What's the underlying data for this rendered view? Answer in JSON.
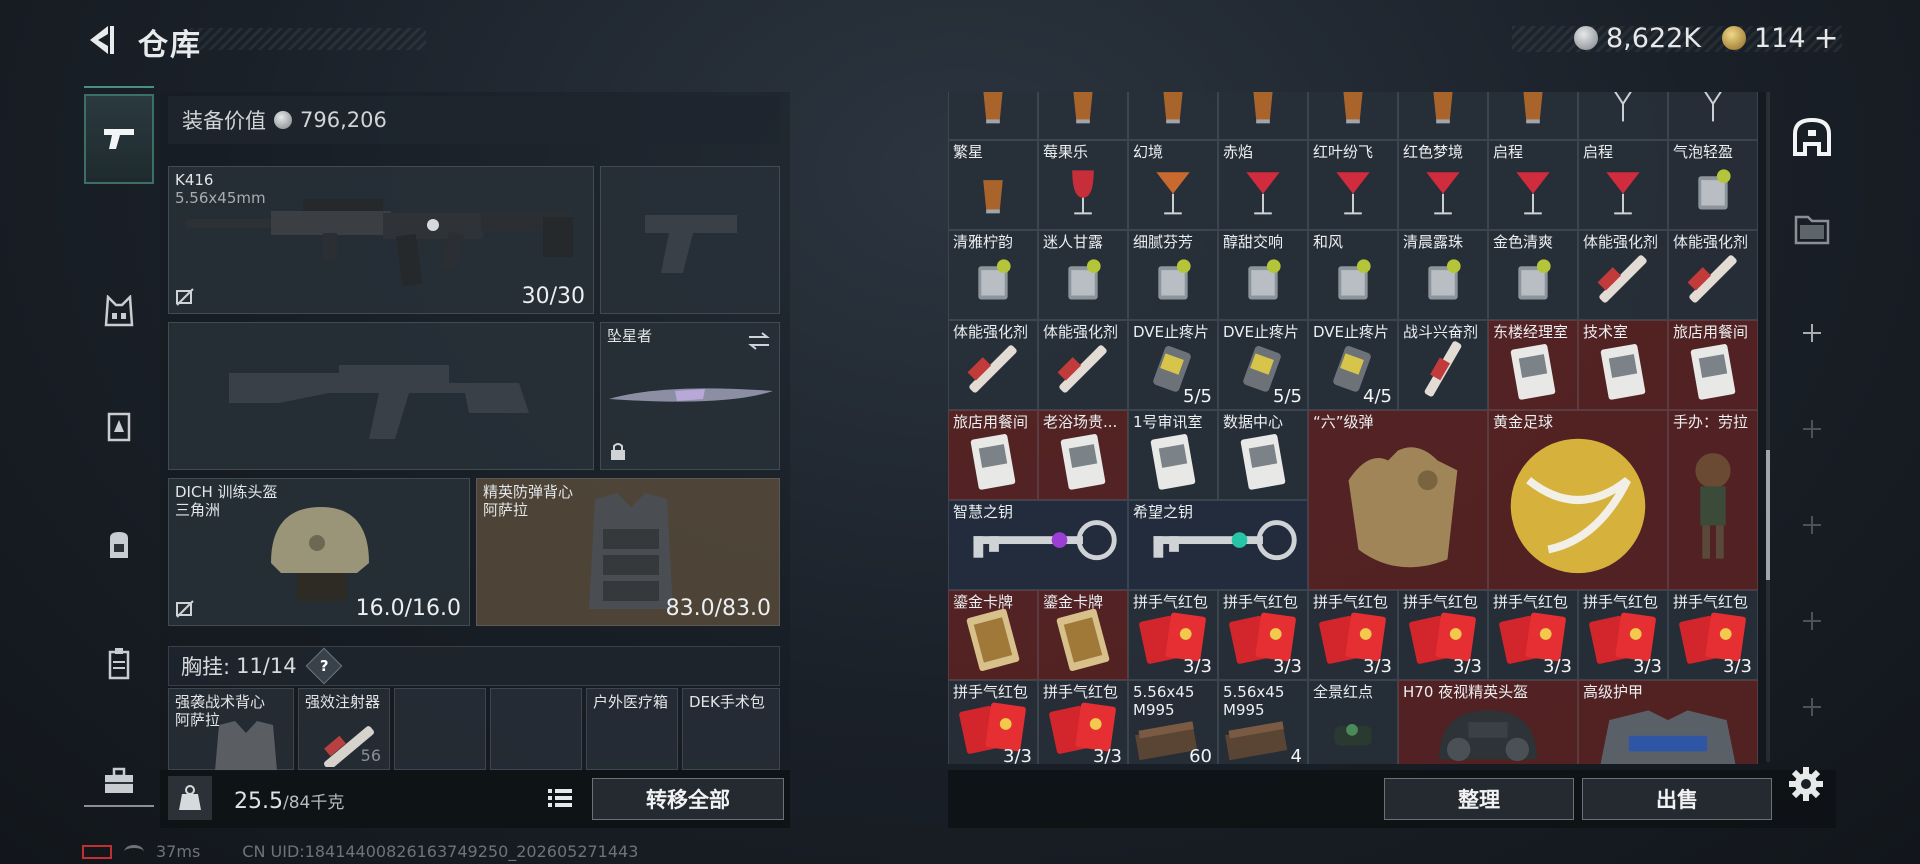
{
  "header": {
    "title": "仓库",
    "currency_1": "8,622K",
    "currency_2": "114",
    "add_symbol": "+"
  },
  "equipment": {
    "value_label": "装备价值",
    "value": "796,206",
    "primary_weapon": {
      "name": "K416",
      "caliber": "5.56x45mm",
      "ammo": "30/30"
    },
    "melee": {
      "name": "坠星者"
    },
    "helmet": {
      "name": "DICH 训练头盔",
      "map": "三角洲",
      "durability": "16.0/16.0"
    },
    "armor": {
      "name": "精英防弹背心",
      "map": "阿萨拉",
      "durability": "83.0/83.0"
    },
    "chest_rig": {
      "label": "胸挂:",
      "capacity": "11/14",
      "help": "?"
    },
    "sub_slots": [
      {
        "name": "强袭战术背心",
        "sub": "阿萨拉"
      },
      {
        "name": "强效注射器",
        "sub": "",
        "count": "56"
      },
      {
        "name": "",
        "sub": ""
      },
      {
        "name": "",
        "sub": ""
      },
      {
        "name": "户外医疗箱",
        "sub": ""
      },
      {
        "name": "DEK手术包",
        "sub": ""
      }
    ],
    "weight": "25.5",
    "weight_max": "/84千克",
    "transfer_all": "转移全部"
  },
  "grid": {
    "rows": [
      [
        {
          "label": "",
          "art": "glass-amber"
        },
        {
          "label": "",
          "art": "glass-amber"
        },
        {
          "label": "",
          "art": "glass-amber"
        },
        {
          "label": "",
          "art": "glass-amber"
        },
        {
          "label": "",
          "art": "glass-amber"
        },
        {
          "label": "",
          "art": "glass-amber"
        },
        {
          "label": "",
          "art": "glass-amber"
        },
        {
          "label": "",
          "art": "glass-clear"
        },
        {
          "label": "",
          "art": "glass-clear"
        }
      ],
      [
        {
          "label": "繁星",
          "art": "glass-amber"
        },
        {
          "label": "莓果乐",
          "art": "glass-red"
        },
        {
          "label": "幻境",
          "art": "glass-martini-amber"
        },
        {
          "label": "赤焰",
          "art": "glass-martini-red"
        },
        {
          "label": "红叶纷飞",
          "art": "glass-martini-red"
        },
        {
          "label": "红色梦境",
          "art": "glass-martini-red"
        },
        {
          "label": "启程",
          "art": "glass-martini-red"
        },
        {
          "label": "启程",
          "art": "glass-martini-red"
        },
        {
          "label": "气泡轻盈",
          "art": "glass-rock"
        }
      ],
      [
        {
          "label": "清雅柠韵",
          "art": "glass-rock"
        },
        {
          "label": "迷人甘露",
          "art": "glass-rock"
        },
        {
          "label": "细腻芬芳",
          "art": "glass-rock"
        },
        {
          "label": "醇甜交响",
          "art": "glass-rock"
        },
        {
          "label": "和风",
          "art": "glass-rock"
        },
        {
          "label": "清晨露珠",
          "art": "glass-rock"
        },
        {
          "label": "金色清爽",
          "art": "glass-rock"
        },
        {
          "label": "体能强化剂",
          "art": "syringe"
        },
        {
          "label": "体能强化剂",
          "art": "syringe"
        }
      ],
      [
        {
          "label": "体能强化剂",
          "art": "syringe"
        },
        {
          "label": "体能强化剂",
          "art": "syringe"
        },
        {
          "label": "DVE止疼片",
          "art": "pills",
          "count": "5/5"
        },
        {
          "label": "DVE止疼片",
          "art": "pills",
          "count": "5/5"
        },
        {
          "label": "DVE止疼片",
          "art": "pills",
          "count": "4/5"
        },
        {
          "label": "战斗兴奋剂",
          "art": "syringe-blue"
        },
        {
          "label": "东楼经理室",
          "art": "card",
          "tone": "red"
        },
        {
          "label": "技术室",
          "art": "card",
          "tone": "red"
        },
        {
          "label": "旅店用餐间",
          "art": "card",
          "tone": "red"
        }
      ],
      [
        {
          "label": "旅店用餐间",
          "art": "card",
          "tone": "red"
        },
        {
          "label": "老浴场贵...",
          "art": "card",
          "tone": "red"
        },
        {
          "label": "1号审讯室",
          "art": "card"
        },
        {
          "label": "数据中心",
          "art": "card"
        }
      ],
      [
        {
          "label": "智慧之钥",
          "art": "key-purple"
        },
        {
          "label": "希望之钥",
          "art": "key-teal"
        }
      ],
      [
        {
          "label": "鎏金卡牌",
          "art": "goldcard",
          "tone": "red"
        },
        {
          "label": "鎏金卡牌",
          "art": "goldcard",
          "tone": "red"
        },
        {
          "label": "拼手气红包",
          "art": "redpacket",
          "count": "3/3"
        },
        {
          "label": "拼手气红包",
          "art": "redpacket",
          "count": "3/3"
        },
        {
          "label": "拼手气红包",
          "art": "redpacket",
          "count": "3/3"
        },
        {
          "label": "拼手气红包",
          "art": "redpacket",
          "count": "3/3"
        },
        {
          "label": "拼手气红包",
          "art": "redpacket",
          "count": "3/3"
        },
        {
          "label": "拼手气红包",
          "art": "redpacket",
          "count": "3/3"
        },
        {
          "label": "拼手气红包",
          "art": "redpacket",
          "count": "3/3"
        }
      ],
      [
        {
          "label": "拼手气红包",
          "art": "redpacket",
          "count": "3/3"
        },
        {
          "label": "拼手气红包",
          "art": "redpacket",
          "count": "3/3"
        },
        {
          "label": "5.56x45\nM995",
          "art": "ammo",
          "count": "60"
        },
        {
          "label": "5.56x45\nM995",
          "art": "ammo",
          "count": "4"
        },
        {
          "label": "全景红点",
          "art": "scope"
        }
      ]
    ],
    "big_items": [
      {
        "label": "“六”级弹",
        "art": "gold-hand"
      },
      {
        "label": "黄金足球",
        "art": "gold-ball"
      },
      {
        "label": "手办：劳拉",
        "art": "figure"
      },
      {
        "label": "H70 夜视精英头盔",
        "art": "nv-helmet"
      },
      {
        "label": "高级护甲",
        "art": "armor"
      }
    ]
  },
  "actions": {
    "sort": "整理",
    "sell": "出售"
  },
  "status": {
    "ping": "37ms",
    "uid": "CN UID:18414400826163749250_202605271443"
  }
}
